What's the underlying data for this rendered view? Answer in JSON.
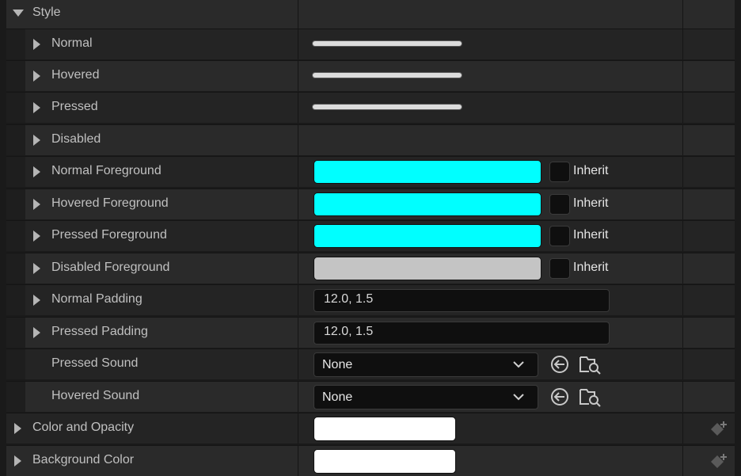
{
  "section": {
    "title": "Style"
  },
  "brush_rows": [
    {
      "label": "Normal"
    },
    {
      "label": "Hovered"
    },
    {
      "label": "Pressed"
    },
    {
      "label": "Disabled"
    }
  ],
  "color_rows": [
    {
      "label": "Normal Foreground",
      "color": "#00ffff",
      "inherit_label": "Inherit"
    },
    {
      "label": "Hovered Foreground",
      "color": "#00ffff",
      "inherit_label": "Inherit"
    },
    {
      "label": "Pressed Foreground",
      "color": "#00ffff",
      "inherit_label": "Inherit"
    },
    {
      "label": "Disabled Foreground",
      "color": "#c4c4c4",
      "inherit_label": "Inherit"
    }
  ],
  "padding_rows": [
    {
      "label": "Normal Padding",
      "value": "12.0, 1.5"
    },
    {
      "label": "Pressed Padding",
      "value": "12.0, 1.5"
    }
  ],
  "sound_rows": [
    {
      "label": "Pressed Sound",
      "value": "None",
      "use_icon": "arrow-left-circle-icon",
      "browse_icon": "folder-search-icon"
    },
    {
      "label": "Hovered Sound",
      "value": "None",
      "use_icon": "arrow-left-circle-icon",
      "browse_icon": "folder-search-icon"
    }
  ],
  "top_rows": [
    {
      "label": "Color and Opacity",
      "color": "#ffffff",
      "icon": "add-keyframe-icon"
    },
    {
      "label": "Background Color",
      "color": "#ffffff",
      "icon": "add-keyframe-icon"
    }
  ]
}
